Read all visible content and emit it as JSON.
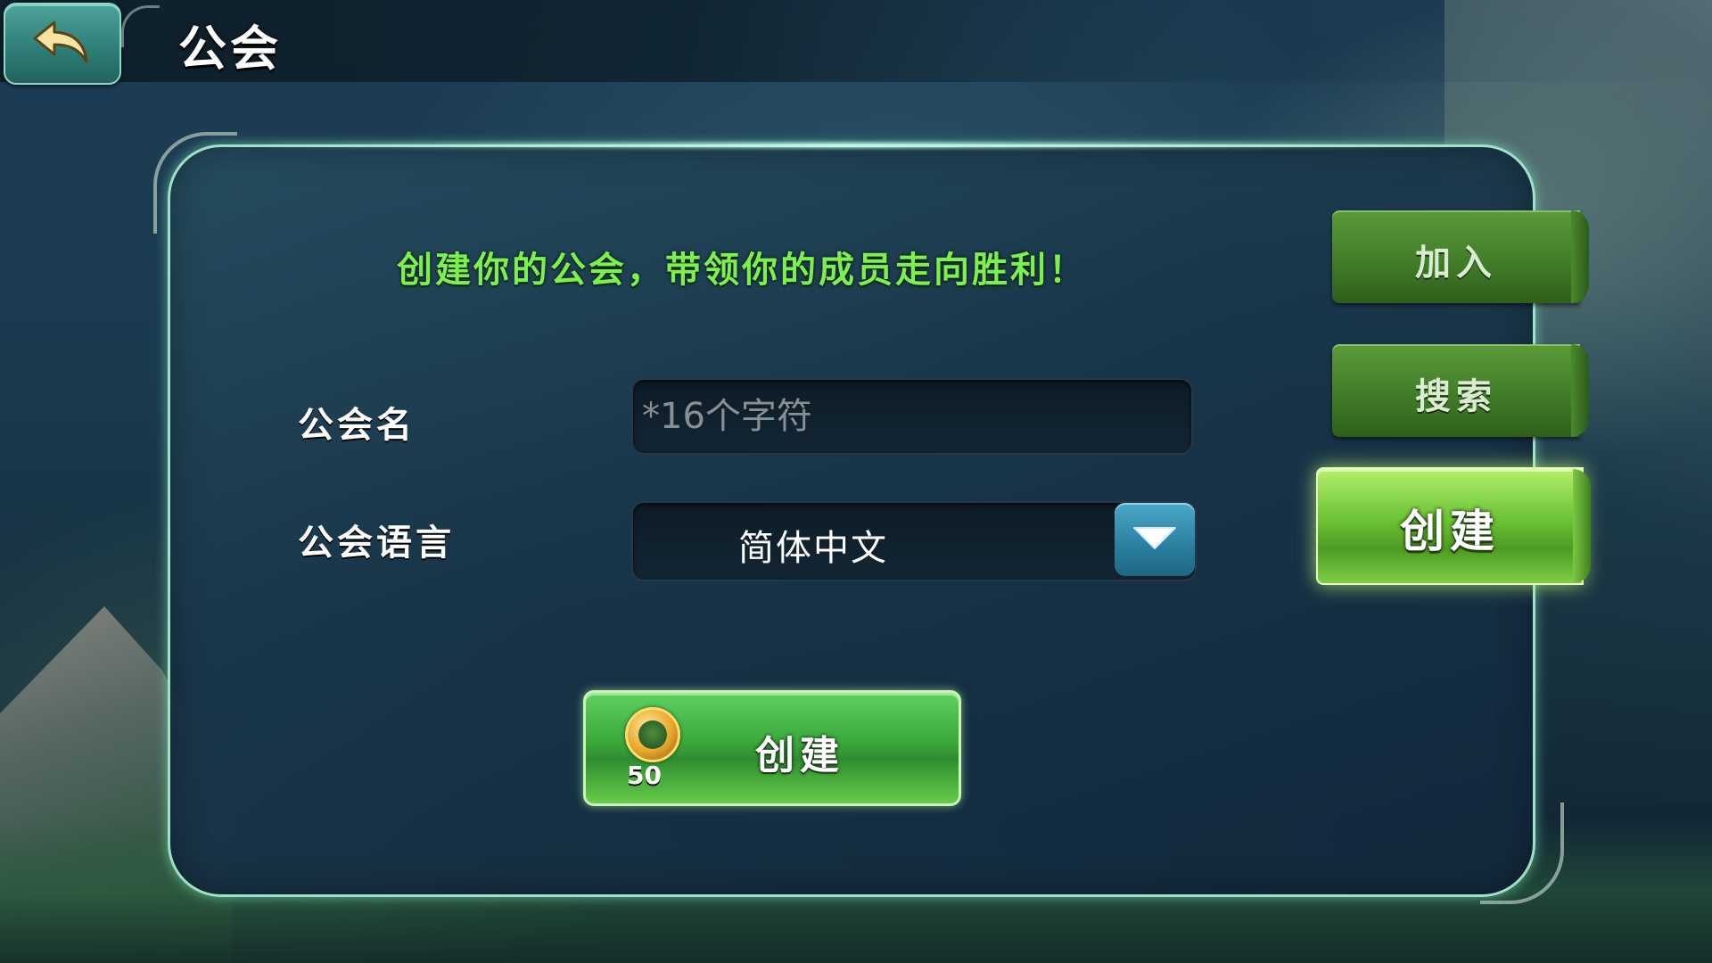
{
  "header": {
    "title": "公会",
    "back_icon": "back-arrow-icon"
  },
  "form": {
    "slogan": "创建你的公会，带领你的成员走向胜利！",
    "name_label": "公会名",
    "name_placeholder": "*16个字符",
    "name_value": "",
    "language_label": "公会语言",
    "language_value": "简体中文",
    "dropdown_icon": "chevron-down-icon"
  },
  "create_action": {
    "label": "创建",
    "cost": "50",
    "currency_icon": "gold-coin-icon"
  },
  "side_tabs": [
    {
      "label": "加入",
      "selected": false
    },
    {
      "label": "搜索",
      "selected": false
    },
    {
      "label": "创建",
      "selected": true
    }
  ],
  "colors": {
    "accent_green": "#7cf04e",
    "panel_border": "#9ee0c8",
    "back_button": "#2f7f78",
    "dropdown_button": "#2b7ea0"
  }
}
